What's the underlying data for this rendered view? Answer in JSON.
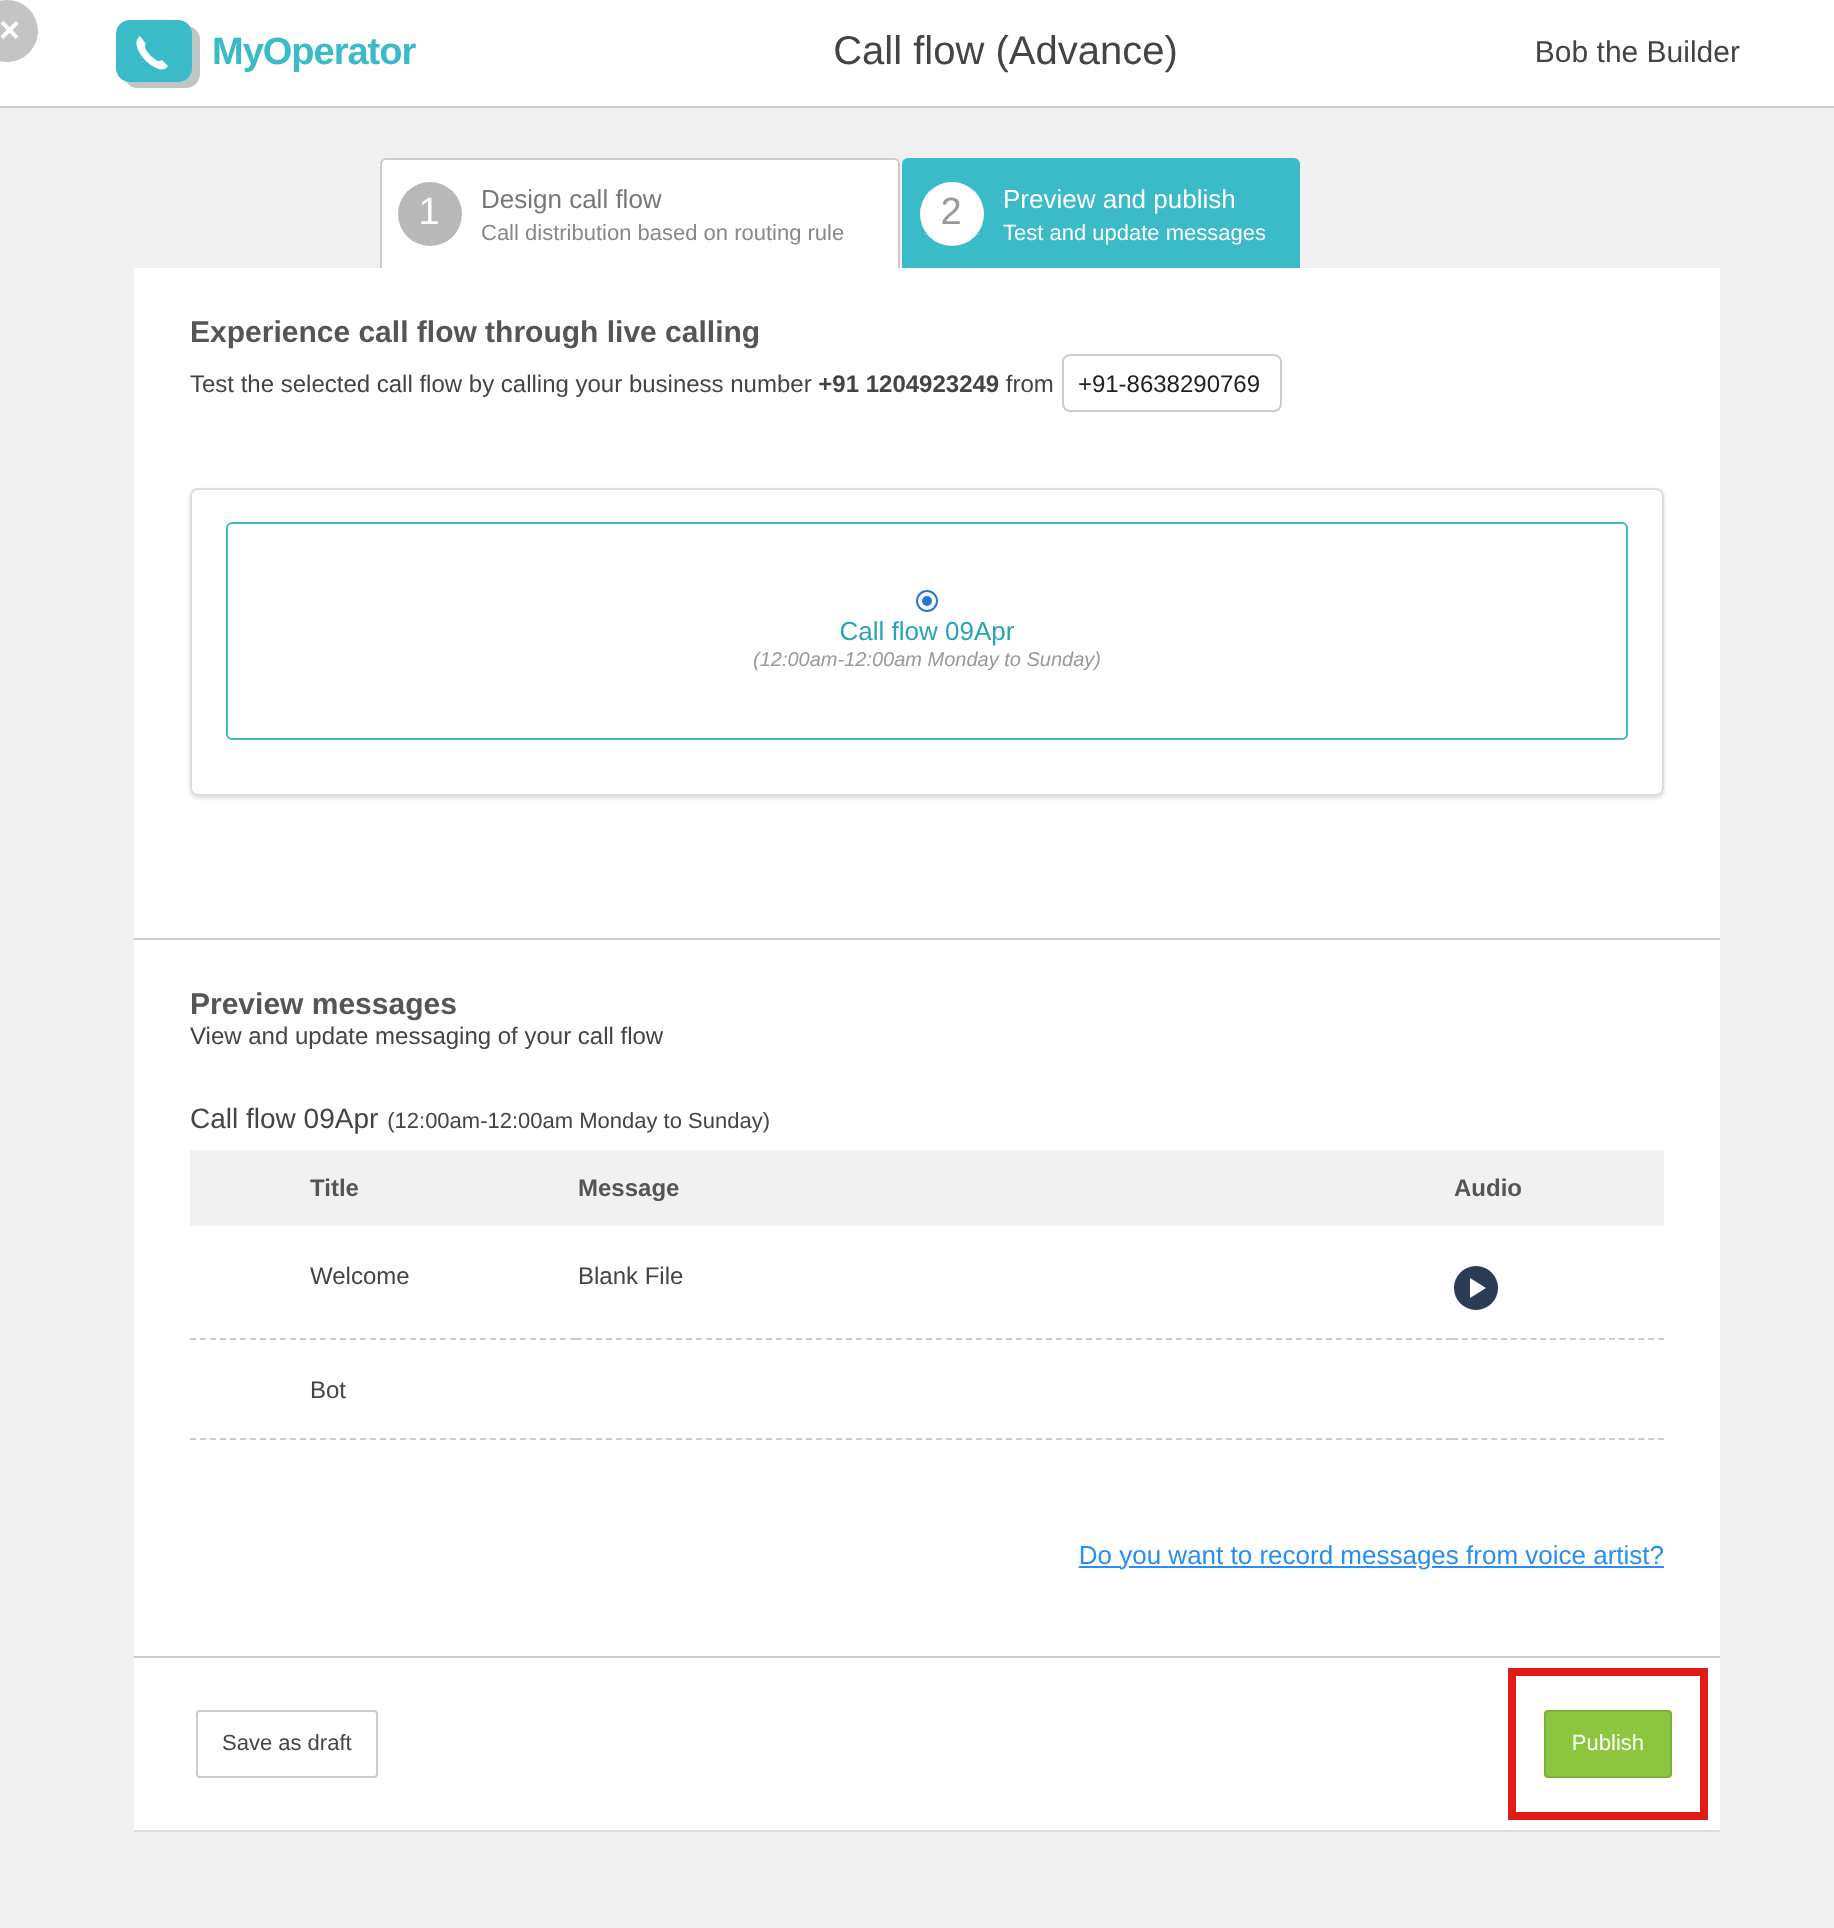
{
  "header": {
    "close_label": "×",
    "brand": "MyOperator",
    "title": "Call flow (Advance)",
    "user": "Bob the Builder"
  },
  "steps": [
    {
      "number": "1",
      "title": "Design call flow",
      "subtitle": "Call distribution based on routing rule",
      "selected": false
    },
    {
      "number": "2",
      "title": "Preview and publish",
      "subtitle": "Test and update messages",
      "selected": true
    }
  ],
  "live_calling": {
    "heading": "Experience call flow through live calling",
    "text": "Test the selected call flow by calling your business number **+91 1204923249** from",
    "from_number": "+91-8638290769",
    "flows": [
      {
        "name": "Call flow 09Apr",
        "hours": "(12:00am-12:00am Monday to Sunday)",
        "selected": true
      }
    ]
  },
  "preview": {
    "heading": "Preview messages",
    "subheading": "View and update messaging of your call flow",
    "flow_name": "Call flow 09Apr",
    "flow_hours": "(12:00am-12:00am Monday to Sunday)",
    "table": {
      "columns": [
        "Title",
        "Message",
        "Audio"
      ],
      "rows": [
        {
          "title": "Welcome",
          "message": "Blank File",
          "audio": true
        },
        {
          "title": "Bot",
          "audio": false
        }
      ]
    },
    "link": "Do you want to record messages from voice artist?"
  },
  "footer": {
    "draft_button": "Save as draft",
    "publish_button": "Publish",
    "publish_highlighted": true
  }
}
